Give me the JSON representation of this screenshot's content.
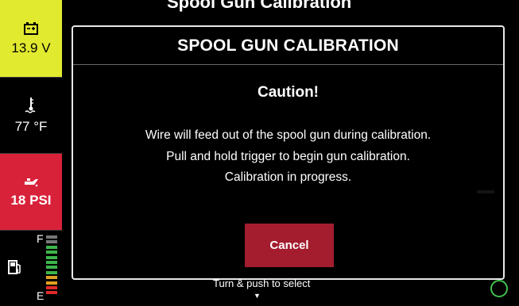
{
  "status": {
    "battery": {
      "value": "13.9 V",
      "icon": "battery-icon",
      "bg": "#e2ea2f"
    },
    "coolant": {
      "value": "77 °F",
      "icon": "thermometer-icon"
    },
    "oil": {
      "value": "18 PSI",
      "icon": "oil-can-icon",
      "bg": "#d8223a"
    },
    "fuel": {
      "full_label": "F",
      "empty_label": "E",
      "icon": "fuel-pump-icon",
      "bars": 12
    }
  },
  "background": {
    "title": "Spool Gun Calibration",
    "hint": "Turn & push to select"
  },
  "dialog": {
    "title": "SPOOL GUN CALIBRATION",
    "caution": "Caution!",
    "lines": [
      "Wire will feed out of the spool gun during calibration.",
      "Pull and hold trigger to begin gun calibration.",
      "Calibration in progress."
    ],
    "cancel_label": "Cancel",
    "button_color": "#a31d2e"
  }
}
